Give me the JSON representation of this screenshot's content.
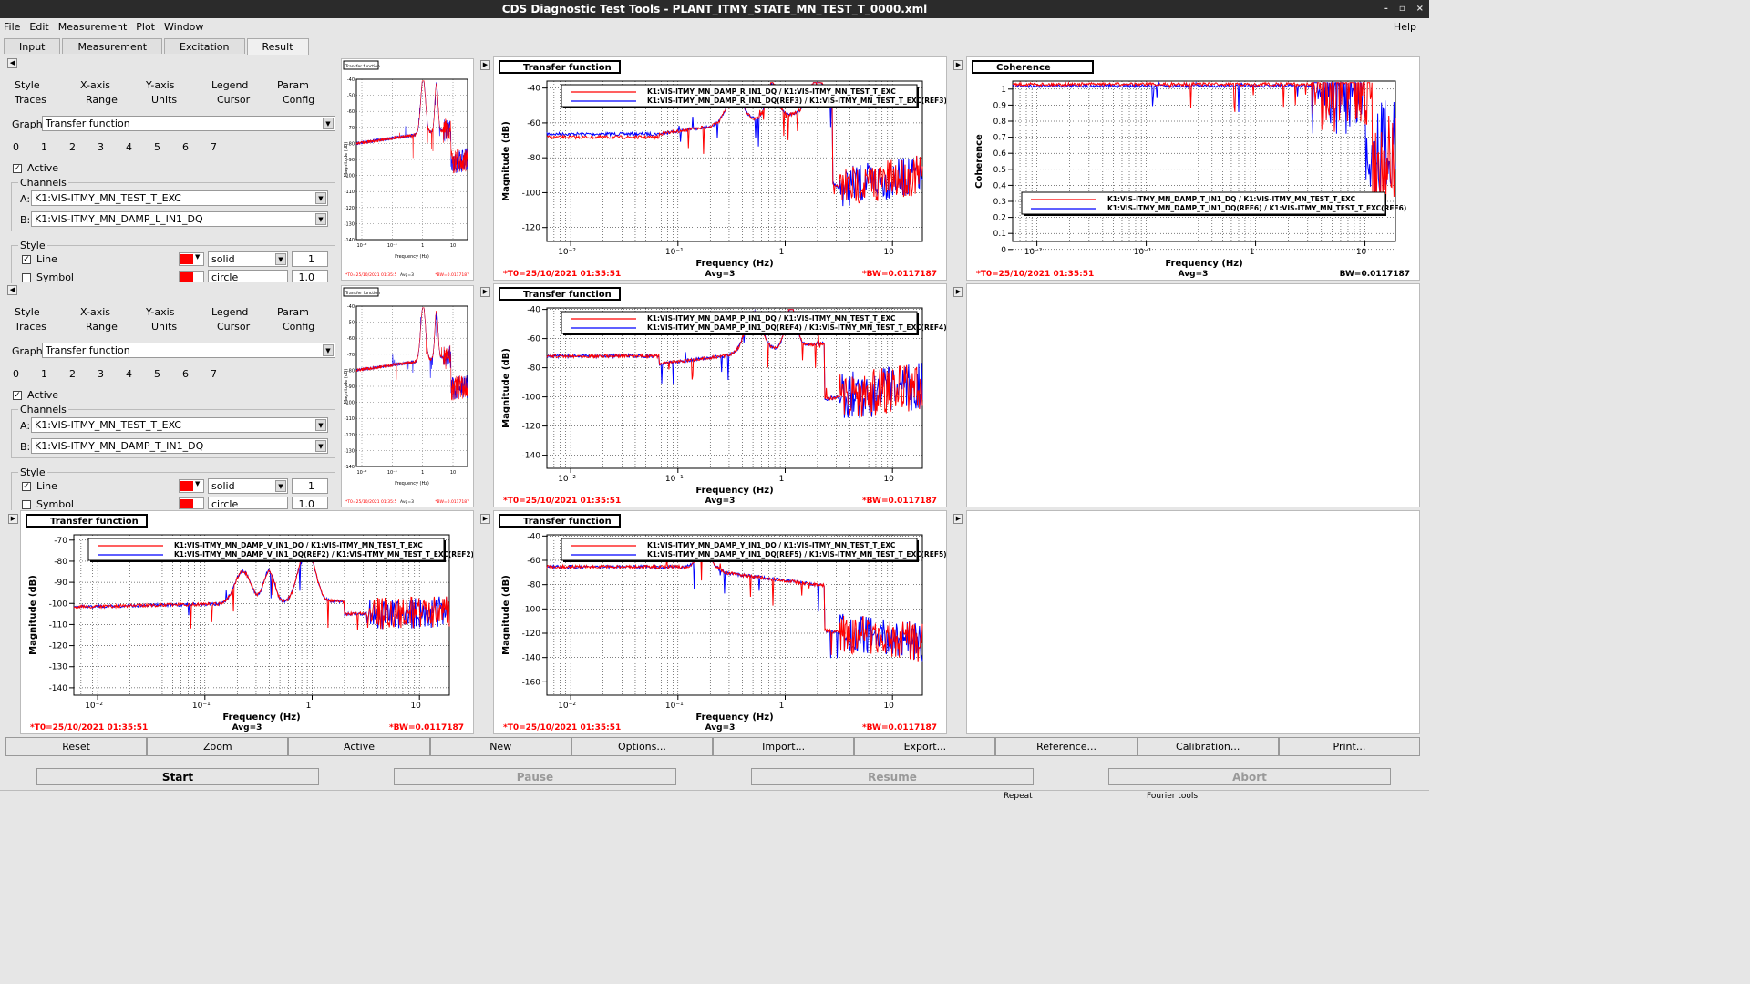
{
  "window": {
    "title": "CDS Diagnostic Test Tools - PLANT_ITMY_STATE_MN_TEST_T_0000.xml",
    "ctrls": [
      "–",
      "▫",
      "×"
    ]
  },
  "menu": {
    "file": "File",
    "edit": "Edit",
    "measurement": "Measurement",
    "plot": "Plot",
    "window": "Window",
    "help": "Help"
  },
  "tabs": [
    "Input",
    "Measurement",
    "Excitation",
    "Result"
  ],
  "active_tab": "Result",
  "controls": [
    {
      "tabs_row1": [
        "Style",
        "X-axis",
        "Y-axis",
        "Legend",
        "Param"
      ],
      "tabs_row2": [
        "Traces",
        "Range",
        "Units",
        "Cursor",
        "Config"
      ],
      "graph_label": "Graph:",
      "graph": "Transfer function",
      "trace_nums": [
        "0",
        "1",
        "2",
        "3",
        "4",
        "5",
        "6",
        "7"
      ],
      "active_label": "Active",
      "channels_label": "Channels",
      "a_label": "A:",
      "channel_a": "K1:VIS-ITMY_MN_TEST_T_EXC",
      "b_label": "B:",
      "channel_b": "K1:VIS-ITMY_MN_DAMP_L_IN1_DQ",
      "style_label": "Style",
      "line_label": "Line",
      "line_style": "solid",
      "line_width": "1",
      "symbol_label": "Symbol",
      "symbol_style": "circle",
      "symbol_size": "1.0"
    },
    {
      "tabs_row1": [
        "Style",
        "X-axis",
        "Y-axis",
        "Legend",
        "Param"
      ],
      "tabs_row2": [
        "Traces",
        "Range",
        "Units",
        "Cursor",
        "Config"
      ],
      "graph_label": "Graph:",
      "graph": "Transfer function",
      "trace_nums": [
        "0",
        "1",
        "2",
        "3",
        "4",
        "5",
        "6",
        "7"
      ],
      "active_label": "Active",
      "channels_label": "Channels",
      "a_label": "A:",
      "channel_a": "K1:VIS-ITMY_MN_TEST_T_EXC",
      "b_label": "B:",
      "channel_b": "K1:VIS-ITMY_MN_DAMP_T_IN1_DQ",
      "style_label": "Style",
      "line_label": "Line",
      "line_style": "solid",
      "line_width": "1",
      "symbol_label": "Symbol",
      "symbol_style": "circle",
      "symbol_size": "1.0"
    }
  ],
  "mini_plots": [
    {
      "title": "Transfer function",
      "y_ticks": [
        "-40",
        "-50",
        "-60",
        "-70",
        "-80",
        "-90",
        "-100",
        "-110",
        "-120",
        "-130",
        "-140"
      ],
      "x_ticks": [
        "10⁻²",
        "10⁻¹",
        "1",
        "10"
      ],
      "xlabel": "Frequency (Hz)",
      "ylabel": "Magnitude (dB)",
      "t0": "*T0=25/10/2021 01:35:5",
      "avg": "Avg=3",
      "bw": "*BW=0.0117187"
    },
    {
      "title": "Transfer function",
      "y_ticks": [
        "-40",
        "-50",
        "-60",
        "-70",
        "-80",
        "-90",
        "-100",
        "-110",
        "-120",
        "-130",
        "-140"
      ],
      "x_ticks": [
        "10⁻²",
        "10⁻¹",
        "1",
        "10"
      ],
      "xlabel": "Frequency (Hz)",
      "ylabel": "Magnitude (dB)",
      "t0": "*T0=25/10/2021 01:35:5",
      "avg": "Avg=3",
      "bw": "*BW=0.0117187"
    }
  ],
  "plots": {
    "r": {
      "title": "Transfer function",
      "ylabel": "Magnitude (dB)",
      "xlabel": "Frequency (Hz)",
      "y_ticks": [
        "-40",
        "-60",
        "-80",
        "-100",
        "-120"
      ],
      "x_ticks": [
        "10⁻²",
        "10⁻¹",
        "1",
        "10"
      ],
      "legend": [
        "K1:VIS-ITMY_MN_DAMP_R_IN1_DQ / K1:VIS-ITMY_MN_TEST_T_EXC",
        "K1:VIS-ITMY_MN_DAMP_R_IN1_DQ(REF3) / K1:VIS-ITMY_MN_TEST_T_EXC(REF3)"
      ],
      "t0": "*T0=25/10/2021 01:35:51",
      "avg": "Avg=3",
      "bw": "*BW=0.0117187"
    },
    "coh": {
      "title": "Coherence",
      "ylabel": "Coherence",
      "xlabel": "Frequency (Hz)",
      "y_ticks": [
        "1",
        "0.9",
        "0.8",
        "0.7",
        "0.6",
        "0.5",
        "0.4",
        "0.3",
        "0.2",
        "0.1",
        "0"
      ],
      "x_ticks": [
        "10⁻²",
        "10⁻¹",
        "1",
        "10"
      ],
      "legend": [
        "K1:VIS-ITMY_MN_DAMP_T_IN1_DQ / K1:VIS-ITMY_MN_TEST_T_EXC",
        "K1:VIS-ITMY_MN_DAMP_T_IN1_DQ(REF6) / K1:VIS-ITMY_MN_TEST_T_EXC(REF6)"
      ],
      "t0": "*T0=25/10/2021 01:35:51",
      "avg": "Avg=3",
      "bw": "BW=0.0117187"
    },
    "p": {
      "title": "Transfer function",
      "ylabel": "Magnitude (dB)",
      "xlabel": "Frequency (Hz)",
      "y_ticks": [
        "-40",
        "-60",
        "-80",
        "-100",
        "-120",
        "-140"
      ],
      "x_ticks": [
        "10⁻²",
        "10⁻¹",
        "1",
        "10"
      ],
      "legend": [
        "K1:VIS-ITMY_MN_DAMP_P_IN1_DQ / K1:VIS-ITMY_MN_TEST_T_EXC",
        "K1:VIS-ITMY_MN_DAMP_P_IN1_DQ(REF4) / K1:VIS-ITMY_MN_TEST_T_EXC(REF4)"
      ],
      "t0": "*T0=25/10/2021 01:35:51",
      "avg": "Avg=3",
      "bw": "*BW=0.0117187"
    },
    "v": {
      "title": "Transfer function",
      "ylabel": "Magnitude (dB)",
      "xlabel": "Frequency (Hz)",
      "y_ticks": [
        "-70",
        "-80",
        "-90",
        "-100",
        "-110",
        "-120",
        "-130",
        "-140"
      ],
      "x_ticks": [
        "10⁻²",
        "10⁻¹",
        "1",
        "10"
      ],
      "legend": [
        "K1:VIS-ITMY_MN_DAMP_V_IN1_DQ / K1:VIS-ITMY_MN_TEST_T_EXC",
        "K1:VIS-ITMY_MN_DAMP_V_IN1_DQ(REF2) / K1:VIS-ITMY_MN_TEST_T_EXC(REF2)"
      ],
      "t0": "*T0=25/10/2021 01:35:51",
      "avg": "Avg=3",
      "bw": "*BW=0.0117187"
    },
    "y": {
      "title": "Transfer function",
      "ylabel": "Magnitude (dB)",
      "xlabel": "Frequency (Hz)",
      "y_ticks": [
        "-40",
        "-60",
        "-80",
        "-100",
        "-120",
        "-140",
        "-160"
      ],
      "x_ticks": [
        "10⁻²",
        "10⁻¹",
        "1",
        "10"
      ],
      "legend": [
        "K1:VIS-ITMY_MN_DAMP_Y_IN1_DQ / K1:VIS-ITMY_MN_TEST_T_EXC",
        "K1:VIS-ITMY_MN_DAMP_Y_IN1_DQ(REF5) / K1:VIS-ITMY_MN_TEST_T_EXC(REF5)"
      ],
      "t0": "*T0=25/10/2021 01:35:51",
      "avg": "Avg=3",
      "bw": "*BW=0.0117187"
    }
  },
  "colors": {
    "current": "#ff0000",
    "reference": "#0000ff"
  },
  "buttons": [
    "Reset",
    "Zoom",
    "Active",
    "New",
    "Options...",
    "Import...",
    "Export...",
    "Reference...",
    "Calibration...",
    "Print..."
  ],
  "run": {
    "start": "Start",
    "pause": "Pause",
    "resume": "Resume",
    "abort": "Abort"
  },
  "status": {
    "repeat": "Repeat",
    "fourier": "Fourier tools"
  }
}
